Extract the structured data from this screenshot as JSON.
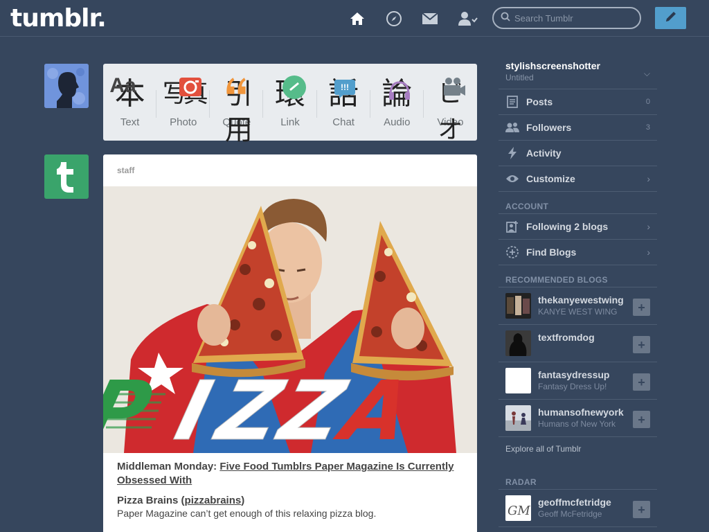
{
  "header": {
    "logo": "tumblr.",
    "search_placeholder": "Search Tumblr",
    "nav_icons": [
      "home-icon",
      "compass-icon",
      "mail-icon",
      "account-icon"
    ],
    "compose_icon": "pencil-icon"
  },
  "post_types": [
    {
      "label": "Text",
      "glyph": "本",
      "icon": "text-aa-icon"
    },
    {
      "label": "Photo",
      "glyph": "写真",
      "icon": "camera-icon"
    },
    {
      "label": "Quote",
      "glyph": "引用",
      "icon": "quote-icon"
    },
    {
      "label": "Link",
      "glyph": "環",
      "icon": "link-icon"
    },
    {
      "label": "Chat",
      "glyph": "話",
      "icon": "chat-icon"
    },
    {
      "label": "Audio",
      "glyph": "論",
      "icon": "headphones-icon"
    },
    {
      "label": "Video",
      "glyph": "ビオ",
      "icon": "video-camera-icon"
    }
  ],
  "post": {
    "author": "staff",
    "image_text": "PIZZA",
    "title_prefix": "Middleman Monday:",
    "title_link": "Five Food Tumblrs Paper Magazine Is Currently Obsessed With",
    "sub_title": "Pizza Brains",
    "sub_link": "pizzabrains",
    "description": "Paper Magazine can’t get enough of this relaxing pizza blog."
  },
  "sidebar": {
    "blog_name": "stylishscreenshotter",
    "blog_sub": "Untitled",
    "items": [
      {
        "label": "Posts",
        "count": "0",
        "icon": "posts-icon"
      },
      {
        "label": "Followers",
        "count": "3",
        "icon": "followers-icon"
      },
      {
        "label": "Activity",
        "count": "",
        "icon": "activity-icon"
      },
      {
        "label": "Customize",
        "count": "",
        "icon": "eye-icon"
      }
    ],
    "account_head": "ACCOUNT",
    "account_items": [
      {
        "label": "Following 2 blogs",
        "icon": "following-icon"
      },
      {
        "label": "Find Blogs",
        "icon": "find-blogs-icon"
      }
    ],
    "recommended_head": "RECOMMENDED BLOGS",
    "recommended": [
      {
        "name": "thekanyewestwing",
        "sub": "KANYE WEST WING"
      },
      {
        "name": "textfromdog",
        "sub": ""
      },
      {
        "name": "fantasydressup",
        "sub": "Fantasy Dress Up!"
      },
      {
        "name": "humansofnewyork",
        "sub": "Humans of New York"
      }
    ],
    "explore": "Explore all of Tumblr",
    "radar_head": "RADAR",
    "radar": {
      "name": "geoffmcfetridge",
      "sub": "Geoff McFetridge"
    }
  },
  "colors": {
    "background": "#36465d",
    "accent": "#529ecc",
    "staff_avatar": "#3aa46b"
  }
}
